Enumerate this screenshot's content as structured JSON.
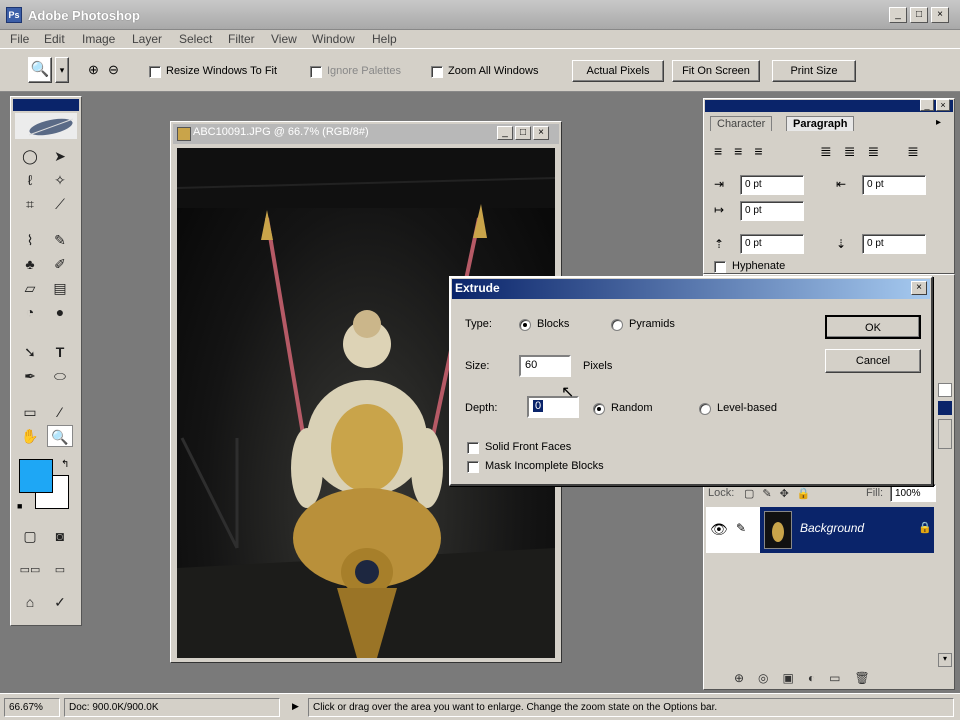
{
  "app": {
    "title": "Adobe Photoshop"
  },
  "menu": [
    "File",
    "Edit",
    "Image",
    "Layer",
    "Select",
    "Filter",
    "View",
    "Window",
    "Help"
  ],
  "options_bar": {
    "resize_windows": "Resize Windows To Fit",
    "ignore_palettes": "Ignore Palettes",
    "zoom_all": "Zoom All Windows",
    "actual_pixels": "Actual Pixels",
    "fit_on_screen": "Fit On Screen",
    "print_size": "Print Size"
  },
  "document": {
    "title": "ABC10091.JPG @ 66.7% (RGB/8#)"
  },
  "char_panel": {
    "tab_character": "Character",
    "tab_paragraph": "Paragraph",
    "indent_left": "0 pt",
    "indent_right": "0 pt",
    "first_line": "0 pt",
    "space_before": "0 pt",
    "space_after": "0 pt",
    "hyphenate": "Hyphenate"
  },
  "layers_panel": {
    "lock_label": "Lock:",
    "fill_label": "Fill:",
    "fill_value": "100%",
    "layer_name": "Background"
  },
  "dialog": {
    "title": "Extrude",
    "type_label": "Type:",
    "type_blocks": "Blocks",
    "type_pyramids": "Pyramids",
    "size_label": "Size:",
    "size_value": "60",
    "size_unit": "Pixels",
    "depth_label": "Depth:",
    "depth_value": "0",
    "depth_random": "Random",
    "depth_level": "Level-based",
    "solid_front": "Solid Front Faces",
    "mask_incomplete": "Mask Incomplete Blocks",
    "ok": "OK",
    "cancel": "Cancel"
  },
  "status": {
    "zoom": "66.67%",
    "doc": "Doc: 900.0K/900.0K",
    "hint": "Click or drag over the area you want to enlarge. Change the zoom state on the Options bar."
  },
  "colors": {
    "foreground": "#1ea7f5",
    "background": "#ffffff",
    "titlebar_active": "#0a246a"
  },
  "icons": [
    "zoom-tool-icon",
    "marquee-icon",
    "move-icon",
    "lasso-icon",
    "magic-wand-icon",
    "crop-icon",
    "brush-icon",
    "text-icon",
    "eyedropper-icon",
    "hand-icon",
    "eye-icon"
  ]
}
